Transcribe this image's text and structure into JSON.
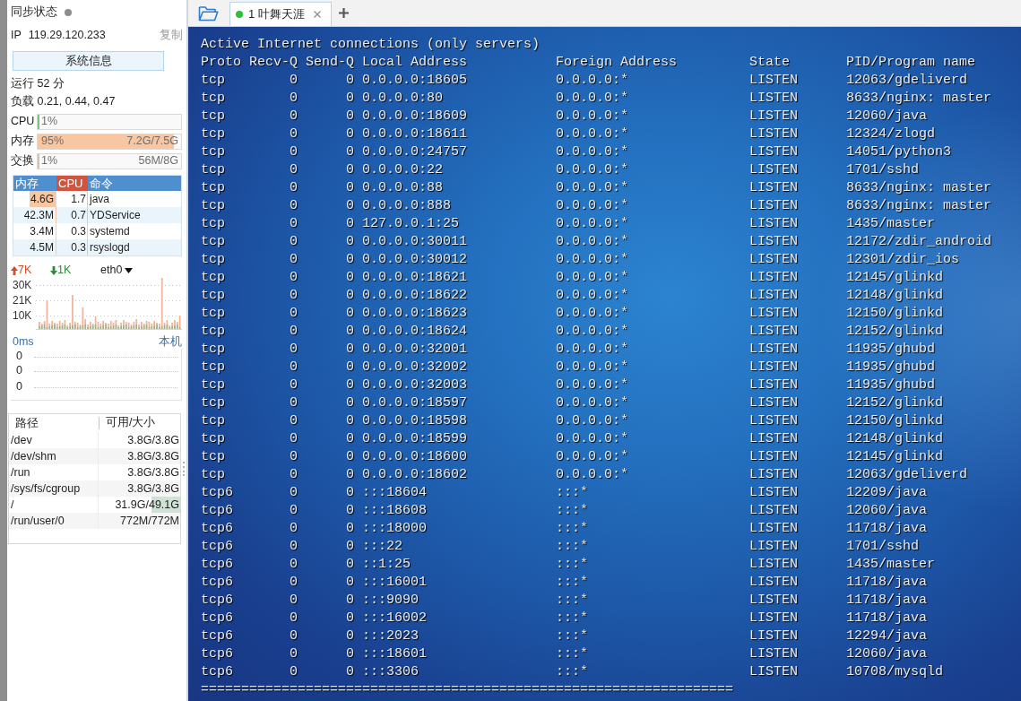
{
  "sidebar": {
    "sync": {
      "label": "同步状态",
      "on": false
    },
    "ip": {
      "label": "IP",
      "address": "119.29.120.233",
      "copy": "复制"
    },
    "system_info_button": "系统信息",
    "uptime": "运行 52 分",
    "load": "负载 0.21, 0.44, 0.47",
    "meters": [
      {
        "kind": "cpu",
        "label": "CPU",
        "reading": "1%",
        "level": 0.01
      },
      {
        "kind": "memory",
        "label": "内存",
        "reading": "95%",
        "amount": "7.2G/7.5G",
        "level": 0.95
      },
      {
        "kind": "swap",
        "label": "交换",
        "reading": "1%",
        "amount": "56M/8G",
        "level": 0.01
      }
    ],
    "processes": {
      "columns": [
        {
          "label": "内存",
          "sorted": false
        },
        {
          "label": "CPU",
          "sorted": true
        },
        {
          "label": "命令",
          "sorted": false
        }
      ],
      "rows": [
        {
          "memory": "4.6G",
          "cpu": "1.7",
          "command": "java",
          "level": 0.61
        },
        {
          "memory": "42.3M",
          "cpu": "0.7",
          "command": "YDService",
          "level": 0.01
        },
        {
          "memory": "3.4M",
          "cpu": "0.3",
          "command": "systemd",
          "level": 0
        },
        {
          "memory": "4.5M",
          "cpu": "0.3",
          "command": "rsyslogd",
          "level": 0
        }
      ]
    },
    "network": {
      "upload": "7K",
      "download": "1K",
      "interface": "eth0",
      "axis_labels": [
        "30K",
        "21K",
        "10K"
      ]
    },
    "latency": {
      "value": "0ms",
      "host": "本机",
      "axis_labels": [
        "0",
        "0",
        "0"
      ]
    },
    "disks": {
      "columns": [
        "路径",
        "可用/大小"
      ],
      "rows": [
        {
          "path": "/dev",
          "usage": "3.8G/3.8G",
          "level": 0
        },
        {
          "path": "/dev/shm",
          "usage": "3.8G/3.8G",
          "level": 0
        },
        {
          "path": "/run",
          "usage": "3.8G/3.8G",
          "level": 0
        },
        {
          "path": "/sys/fs/cgroup",
          "usage": "3.8G/3.8G",
          "level": 0
        },
        {
          "path": "/",
          "usage": "31.9G/49.1G",
          "level": 0.35
        },
        {
          "path": "/run/user/0",
          "usage": "772M/772M",
          "level": 0
        }
      ]
    }
  },
  "tabbar": {
    "tabs": [
      {
        "label": "1 叶舞天涯",
        "selected": true,
        "connected": true
      }
    ]
  },
  "terminal": {
    "heading": "Active Internet connections (only servers)",
    "columns": [
      "Proto",
      "Recv-Q",
      "Send-Q",
      "Local Address",
      "Foreign Address",
      "State",
      "PID/Program name"
    ],
    "rows": [
      [
        "tcp",
        "0",
        "0",
        "0.0.0.0:18605",
        "0.0.0.0:*",
        "LISTEN",
        "12063/gdeliverd"
      ],
      [
        "tcp",
        "0",
        "0",
        "0.0.0.0:80",
        "0.0.0.0:*",
        "LISTEN",
        "8633/nginx: master"
      ],
      [
        "tcp",
        "0",
        "0",
        "0.0.0.0:18609",
        "0.0.0.0:*",
        "LISTEN",
        "12060/java"
      ],
      [
        "tcp",
        "0",
        "0",
        "0.0.0.0:18611",
        "0.0.0.0:*",
        "LISTEN",
        "12324/zlogd"
      ],
      [
        "tcp",
        "0",
        "0",
        "0.0.0.0:24757",
        "0.0.0.0:*",
        "LISTEN",
        "14051/python3"
      ],
      [
        "tcp",
        "0",
        "0",
        "0.0.0.0:22",
        "0.0.0.0:*",
        "LISTEN",
        "1701/sshd"
      ],
      [
        "tcp",
        "0",
        "0",
        "0.0.0.0:88",
        "0.0.0.0:*",
        "LISTEN",
        "8633/nginx: master"
      ],
      [
        "tcp",
        "0",
        "0",
        "0.0.0.0:888",
        "0.0.0.0:*",
        "LISTEN",
        "8633/nginx: master"
      ],
      [
        "tcp",
        "0",
        "0",
        "127.0.0.1:25",
        "0.0.0.0:*",
        "LISTEN",
        "1435/master"
      ],
      [
        "tcp",
        "0",
        "0",
        "0.0.0.0:30011",
        "0.0.0.0:*",
        "LISTEN",
        "12172/zdir_android"
      ],
      [
        "tcp",
        "0",
        "0",
        "0.0.0.0:30012",
        "0.0.0.0:*",
        "LISTEN",
        "12301/zdir_ios"
      ],
      [
        "tcp",
        "0",
        "0",
        "0.0.0.0:18621",
        "0.0.0.0:*",
        "LISTEN",
        "12145/glinkd"
      ],
      [
        "tcp",
        "0",
        "0",
        "0.0.0.0:18622",
        "0.0.0.0:*",
        "LISTEN",
        "12148/glinkd"
      ],
      [
        "tcp",
        "0",
        "0",
        "0.0.0.0:18623",
        "0.0.0.0:*",
        "LISTEN",
        "12150/glinkd"
      ],
      [
        "tcp",
        "0",
        "0",
        "0.0.0.0:18624",
        "0.0.0.0:*",
        "LISTEN",
        "12152/glinkd"
      ],
      [
        "tcp",
        "0",
        "0",
        "0.0.0.0:32001",
        "0.0.0.0:*",
        "LISTEN",
        "11935/ghubd"
      ],
      [
        "tcp",
        "0",
        "0",
        "0.0.0.0:32002",
        "0.0.0.0:*",
        "LISTEN",
        "11935/ghubd"
      ],
      [
        "tcp",
        "0",
        "0",
        "0.0.0.0:32003",
        "0.0.0.0:*",
        "LISTEN",
        "11935/ghubd"
      ],
      [
        "tcp",
        "0",
        "0",
        "0.0.0.0:18597",
        "0.0.0.0:*",
        "LISTEN",
        "12152/glinkd"
      ],
      [
        "tcp",
        "0",
        "0",
        "0.0.0.0:18598",
        "0.0.0.0:*",
        "LISTEN",
        "12150/glinkd"
      ],
      [
        "tcp",
        "0",
        "0",
        "0.0.0.0:18599",
        "0.0.0.0:*",
        "LISTEN",
        "12148/glinkd"
      ],
      [
        "tcp",
        "0",
        "0",
        "0.0.0.0:18600",
        "0.0.0.0:*",
        "LISTEN",
        "12145/glinkd"
      ],
      [
        "tcp",
        "0",
        "0",
        "0.0.0.0:18602",
        "0.0.0.0:*",
        "LISTEN",
        "12063/gdeliverd"
      ],
      [
        "tcp6",
        "0",
        "0",
        ":::18604",
        ":::*",
        "LISTEN",
        "12209/java"
      ],
      [
        "tcp6",
        "0",
        "0",
        ":::18608",
        ":::*",
        "LISTEN",
        "12060/java"
      ],
      [
        "tcp6",
        "0",
        "0",
        ":::18000",
        ":::*",
        "LISTEN",
        "11718/java"
      ],
      [
        "tcp6",
        "0",
        "0",
        ":::22",
        ":::*",
        "LISTEN",
        "1701/sshd"
      ],
      [
        "tcp6",
        "0",
        "0",
        "::1:25",
        ":::*",
        "LISTEN",
        "1435/master"
      ],
      [
        "tcp6",
        "0",
        "0",
        ":::16001",
        ":::*",
        "LISTEN",
        "11718/java"
      ],
      [
        "tcp6",
        "0",
        "0",
        ":::9090",
        ":::*",
        "LISTEN",
        "11718/java"
      ],
      [
        "tcp6",
        "0",
        "0",
        ":::16002",
        ":::*",
        "LISTEN",
        "11718/java"
      ],
      [
        "tcp6",
        "0",
        "0",
        ":::2023",
        ":::*",
        "LISTEN",
        "12294/java"
      ],
      [
        "tcp6",
        "0",
        "0",
        ":::18601",
        ":::*",
        "LISTEN",
        "12060/java"
      ],
      [
        "tcp6",
        "0",
        "0",
        ":::3306",
        ":::*",
        "LISTEN",
        "10708/mysqld"
      ]
    ],
    "separator": "=================================================================="
  }
}
